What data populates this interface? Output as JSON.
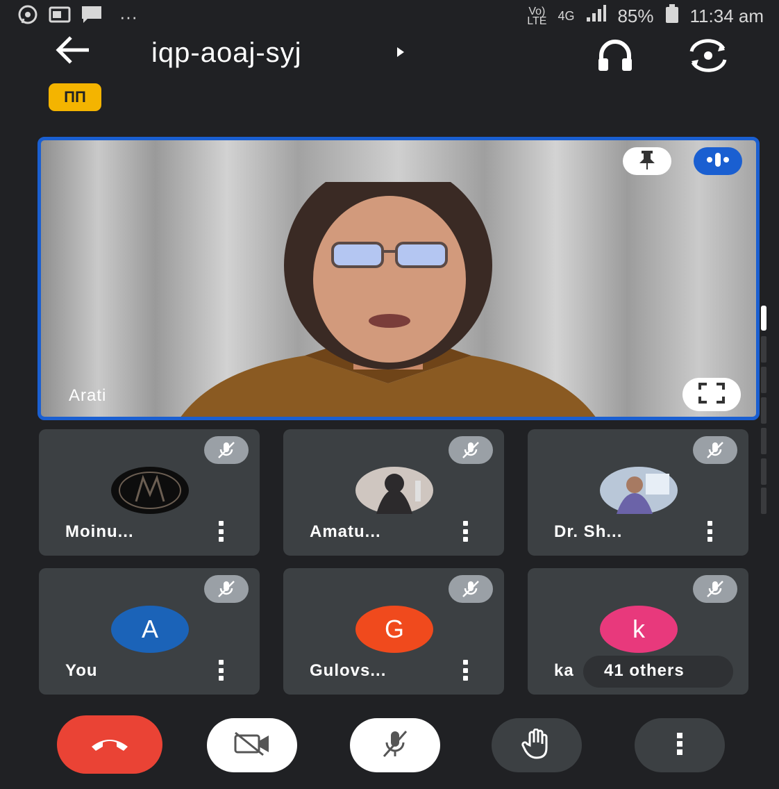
{
  "status_bar": {
    "network_type": "Vo)",
    "network_sub": "LTE",
    "mobile_data": "4G",
    "battery": "85%",
    "time": "11:34 am",
    "more": "···"
  },
  "top_bar": {
    "meeting_code": "iqp-aoaj-syj",
    "badge": "ΠΠ"
  },
  "main_tile": {
    "name": "Arati"
  },
  "participants": [
    {
      "name": "Moinu...",
      "avatar_type": "image",
      "muted": true
    },
    {
      "name": "Amatu...",
      "avatar_type": "image",
      "muted": true
    },
    {
      "name": "Dr. Sh...",
      "avatar_type": "image",
      "muted": true
    },
    {
      "name": "You",
      "avatar_letter": "A",
      "avatar_color": "#1b63b8",
      "muted": true
    },
    {
      "name": "Gulovs...",
      "avatar_letter": "G",
      "avatar_color": "#f04a1d",
      "muted": true
    },
    {
      "name": "ka",
      "avatar_letter": "k",
      "avatar_color": "#e8397c",
      "muted": true,
      "others_label": "41 others"
    }
  ],
  "controls": {
    "end_call_color": "#ea4335",
    "icons": [
      "phone-hangup-icon",
      "camera-off-icon",
      "mic-off-icon",
      "raise-hand-icon",
      "more-vert-icon"
    ]
  }
}
